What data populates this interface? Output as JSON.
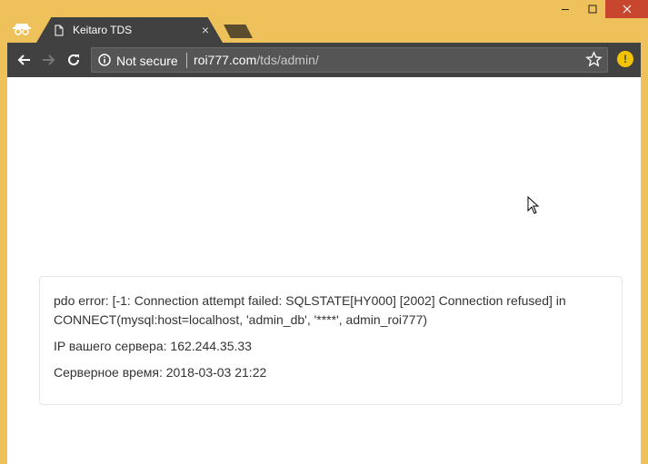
{
  "browser": {
    "tab_title": "Keitaro TDS",
    "tab_close": "×",
    "security": "Not secure",
    "url_domain": "roi777.com",
    "url_path": "/tds/admin/",
    "window_controls": {
      "minimize": "—",
      "maximize": "□",
      "close": "×"
    }
  },
  "page": {
    "error_line": "pdo error: [-1: Connection attempt failed: SQLSTATE[HY000] [2002] Connection refused] in CONNECT(mysql:host=localhost, 'admin_db', '****', admin_roi777)",
    "server_ip": "IP вашего сервера: 162.244.35.33",
    "server_time": "Серверное время: 2018-03-03 21:22"
  },
  "colors": {
    "frame": "#eec15a",
    "toolbar": "#414141",
    "close": "#c7462d",
    "warning": "#f2c400"
  }
}
